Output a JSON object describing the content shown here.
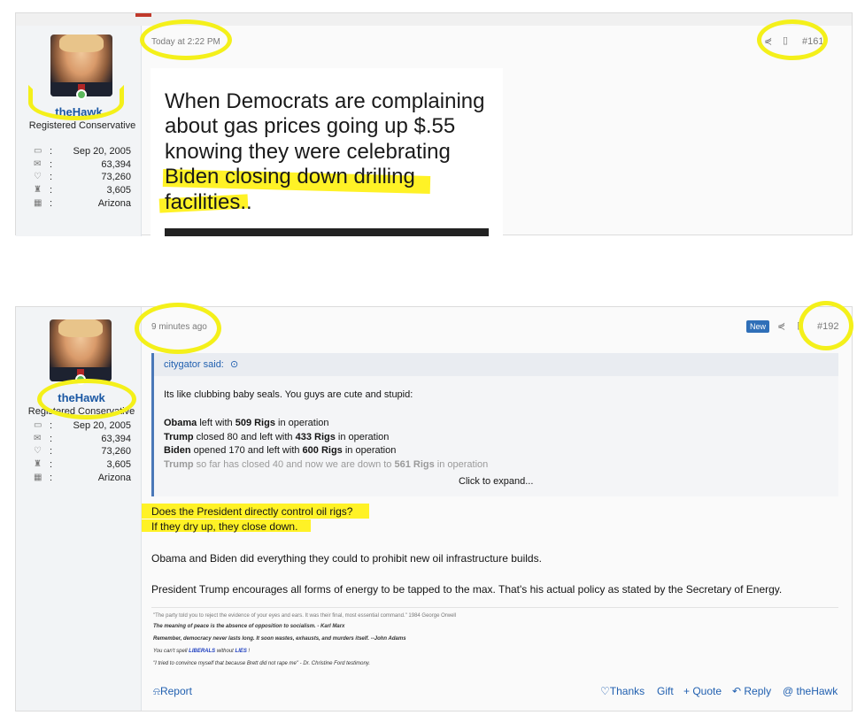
{
  "post1": {
    "user": {
      "name": "theHawk",
      "title": "Registered Conservative"
    },
    "stats": [
      {
        "icon": "calendar-icon",
        "glyph": "▭",
        "value": "Sep 20, 2005"
      },
      {
        "icon": "messages-icon",
        "glyph": "✉",
        "value": "63,394"
      },
      {
        "icon": "reactions-icon",
        "glyph": "♡",
        "value": "73,260"
      },
      {
        "icon": "trophy-icon",
        "glyph": "♜",
        "value": "3,605"
      },
      {
        "icon": "map-icon",
        "glyph": "▦",
        "value": "Arizona"
      }
    ],
    "timestamp": "Today at 2:22 PM",
    "post_number": "#161",
    "meme_lines": [
      "When Democrats are complaining",
      "about gas prices going up $.55",
      "knowing they were celebrating",
      "Biden closing down drilling",
      "facilities.."
    ]
  },
  "post2": {
    "user": {
      "name": "theHawk",
      "title": "Registered Conservative"
    },
    "stats": [
      {
        "icon": "calendar-icon",
        "glyph": "▭",
        "value": "Sep 20, 2005"
      },
      {
        "icon": "messages-icon",
        "glyph": "✉",
        "value": "63,394"
      },
      {
        "icon": "reactions-icon",
        "glyph": "♡",
        "value": "73,260"
      },
      {
        "icon": "trophy-icon",
        "glyph": "♜",
        "value": "3,605"
      },
      {
        "icon": "map-icon",
        "glyph": "▦",
        "value": "Arizona"
      }
    ],
    "timestamp": "9 minutes ago",
    "new_badge": "New",
    "post_number": "#192",
    "quote": {
      "author": "citygator said:",
      "intro": "Its like clubbing baby seals. You guys are cute and stupid:",
      "lines": [
        {
          "name": "Obama",
          "pre": " left with ",
          "num": "509 Rigs",
          "post": " in operation"
        },
        {
          "name": "Trump",
          "pre": " closed 80 and left with ",
          "num": "433 Rigs",
          "post": " in operation"
        },
        {
          "name": "Biden",
          "pre": " opened 170 and left with ",
          "num": "600 Rigs",
          "post": " in operation"
        },
        {
          "name": "Trump",
          "pre": " so far has closed 40 and now we are down to ",
          "num": "561 Rigs",
          "post": " in operation"
        }
      ],
      "expand": "Click to expand..."
    },
    "body": [
      "Does the President directly control oil rigs?",
      "If they dry up, they close down.",
      "Obama and Biden did everything they could to prohibit new oil infrastructure builds.",
      "President Trump encourages all forms of energy to be tapped to the max. That's his actual policy as stated by the Secretary of Energy."
    ],
    "signature": {
      "s1": "\"The party told you to reject the evidence of your eyes and ears. It was their final, most essential command.\"  1984 George Orwell",
      "s2": "The meaning of peace is the absence of opposition to socialism. - Karl Marx",
      "s3": "Remember, democracy never lasts long. It soon wastes, exhausts, and murders itself. --John Adams",
      "s4a": "You can't spell ",
      "s4b": "LIBERALS",
      "s4c": " without ",
      "s4d": "LIES",
      "s4e": " !",
      "s5": "\"I tried to convince myself that because Brett did not rape me\" - Dr. Christine Ford testimony."
    },
    "actions": {
      "report": "Report",
      "thanks": "Thanks",
      "gift": "Gift",
      "quote": "+ Quote",
      "reply": "Reply",
      "mention": "theHawk"
    }
  },
  "colors": {
    "highlight": "#f4f01a",
    "link": "#2160b0",
    "accent": "#4a78b8"
  }
}
